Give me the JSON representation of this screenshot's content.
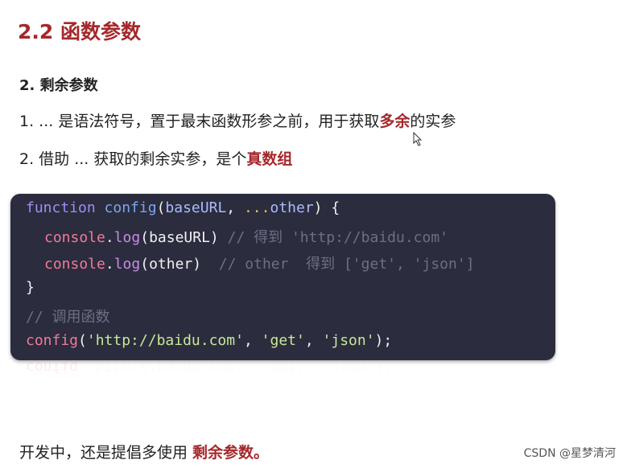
{
  "title": "2.2 函数参数",
  "subtitle": "2. 剩余参数",
  "points": [
    {
      "before": "1. ... 是语法符号，置于最末函数形参之前，用于获取",
      "highlight": "多余",
      "after": "的实参"
    },
    {
      "before": "2. 借助 ... 获取的剩余实参，是个",
      "highlight": "真数组",
      "after": ""
    }
  ],
  "code": {
    "l1": {
      "kw": "function",
      "fn": "config",
      "p1": "(",
      "a1": "baseURL",
      "c": ", ",
      "dots": "...",
      "a2": "other",
      "end": ") {"
    },
    "l2": {
      "obj": "console",
      "dot": ".",
      "me": "log",
      "p": "(",
      "arg": "baseURL",
      "pe": ")",
      "cm": " // 得到 'http://baidu.com'"
    },
    "l3": {
      "obj": "console",
      "dot": ".",
      "me": "log",
      "p": "(",
      "arg": "other",
      "pe": ")",
      "cm": "  // other  得到 ['get', 'json']"
    },
    "l4": "}",
    "l5": "// 调用函数",
    "l6": {
      "fn": "config",
      "p": "(",
      "s1": "'http://baidu.com'",
      "c1": ", ",
      "s2": "'get'",
      "c2": ", ",
      "s3": "'json'",
      "end": ");"
    }
  },
  "footer": {
    "before": "开发中，还是提倡多使用 ",
    "highlight": "剩余参数。"
  },
  "watermark": "CSDN @星梦清河",
  "colors": {
    "accent": "#a5282c",
    "code_bg": "#2b2c3d"
  }
}
